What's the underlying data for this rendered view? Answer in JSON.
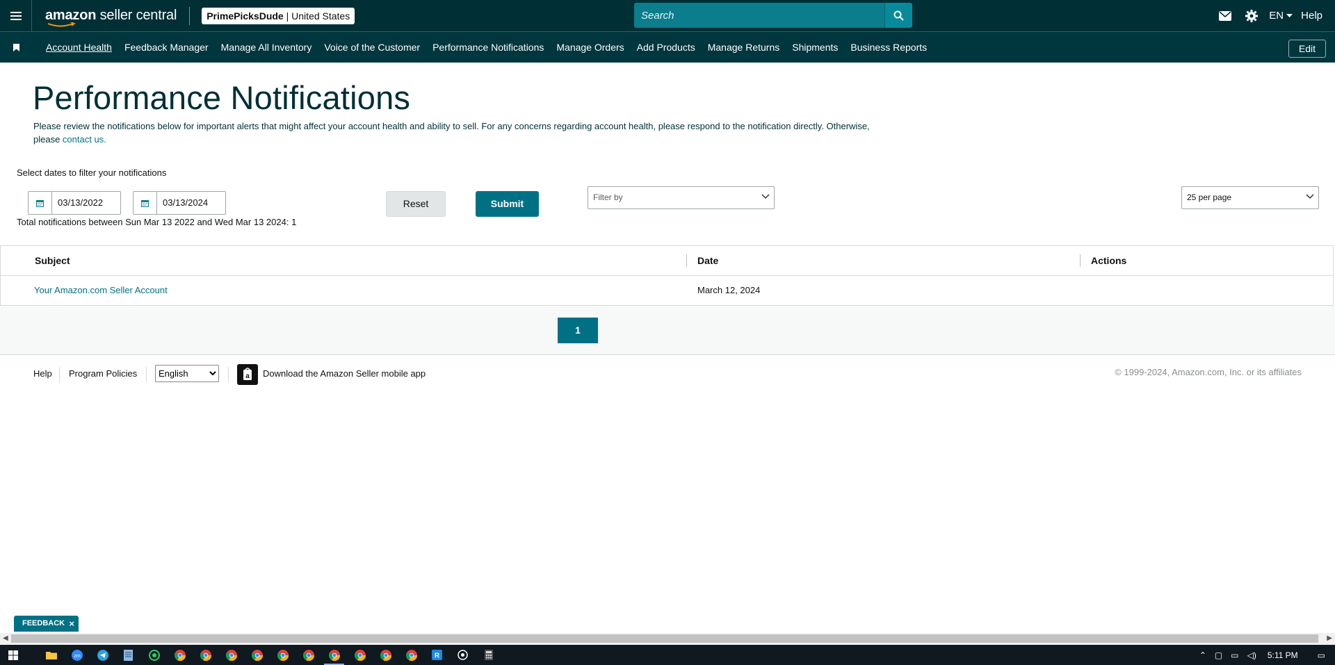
{
  "header": {
    "logo_main": "amazon",
    "logo_sub": "seller central",
    "store_name": "PrimePicksDude",
    "store_sep": " | ",
    "store_region": "United States",
    "search_placeholder": "Search",
    "language": "EN",
    "help": "Help"
  },
  "nav": {
    "items": [
      {
        "label": "Account Health",
        "active": true
      },
      {
        "label": "Feedback Manager"
      },
      {
        "label": "Manage All Inventory"
      },
      {
        "label": "Voice of the Customer"
      },
      {
        "label": "Performance Notifications"
      },
      {
        "label": "Manage Orders"
      },
      {
        "label": "Add Products"
      },
      {
        "label": "Manage Returns"
      },
      {
        "label": "Shipments"
      },
      {
        "label": "Business Reports"
      }
    ],
    "edit": "Edit"
  },
  "main": {
    "title": "Performance Notifications",
    "desc_text": "Please review the notifications below for important alerts that might affect your account health and ability to sell. For any concerns regarding account health, please respond to the notification directly. Otherwise, please ",
    "desc_link": "contact us.",
    "filter_label": "Select dates to filter your notifications",
    "date_from": "03/13/2022",
    "date_to": "03/13/2024",
    "reset": "Reset",
    "submit": "Submit",
    "filter_placeholder": "Filter by",
    "per_page": "25 per page",
    "total_text": "Total notifications between Sun Mar 13 2022 and Wed Mar 13 2024: 1"
  },
  "table": {
    "headers": [
      "Subject",
      "Date",
      "Actions"
    ],
    "rows": [
      {
        "subject": "Your Amazon.com Seller Account",
        "date": "March 12, 2024",
        "actions": ""
      }
    ]
  },
  "pagination": {
    "current": "1"
  },
  "footer": {
    "help": "Help",
    "policies": "Program Policies",
    "language_selected": "English",
    "app_download": "Download the Amazon Seller mobile app",
    "copyright": "© 1999-2024, Amazon.com, Inc. or its affiliates"
  },
  "feedback": {
    "label": "FEEDBACK",
    "close": "×"
  },
  "taskbar": {
    "time": "5:11 PM"
  },
  "colors": {
    "header_bg": "#002f36",
    "nav_bg": "#00363d",
    "accent": "#007185",
    "search_bg": "#0b7d8c"
  }
}
